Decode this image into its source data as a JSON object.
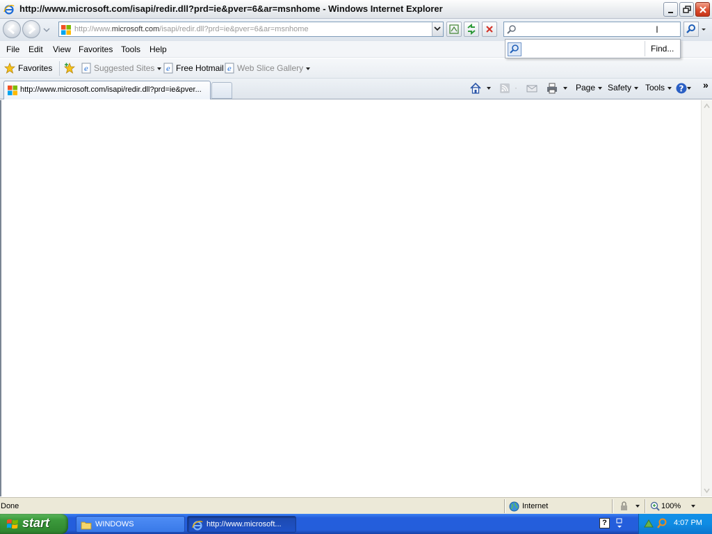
{
  "window": {
    "title": "http://www.microsoft.com/isapi/redir.dll?prd=ie&pver=6&ar=msnhome - Windows Internet Explorer"
  },
  "address": {
    "url_prefix": "http://www.",
    "url_domain": "microsoft.com",
    "url_suffix": "/isapi/redir.dll?prd=ie&pver=6&ar=msnhome"
  },
  "search": {
    "value": "",
    "popup_find": "Find..."
  },
  "menu": [
    "File",
    "Edit",
    "View",
    "Favorites",
    "Tools",
    "Help"
  ],
  "favorites_bar": {
    "favorites": "Favorites",
    "suggested_sites": "Suggested Sites",
    "free_hotmail": "Free Hotmail",
    "web_slice_gallery": "Web Slice Gallery"
  },
  "tab": {
    "label": "http://www.microsoft.com/isapi/redir.dll?prd=ie&pver..."
  },
  "commandbar": {
    "page": "Page",
    "safety": "Safety",
    "tools": "Tools",
    "overflow": "»"
  },
  "statusbar": {
    "status": "Done",
    "zone": "Internet",
    "zoom": "100%"
  },
  "taskbar": {
    "start": "start",
    "items": [
      "WINDOWS",
      "http://www.microsoft..."
    ],
    "clock": "4:07 PM"
  },
  "colors": {
    "taskbar_blue": "#245edc",
    "start_green": "#3c9a3c",
    "close_red": "#d9492a"
  }
}
